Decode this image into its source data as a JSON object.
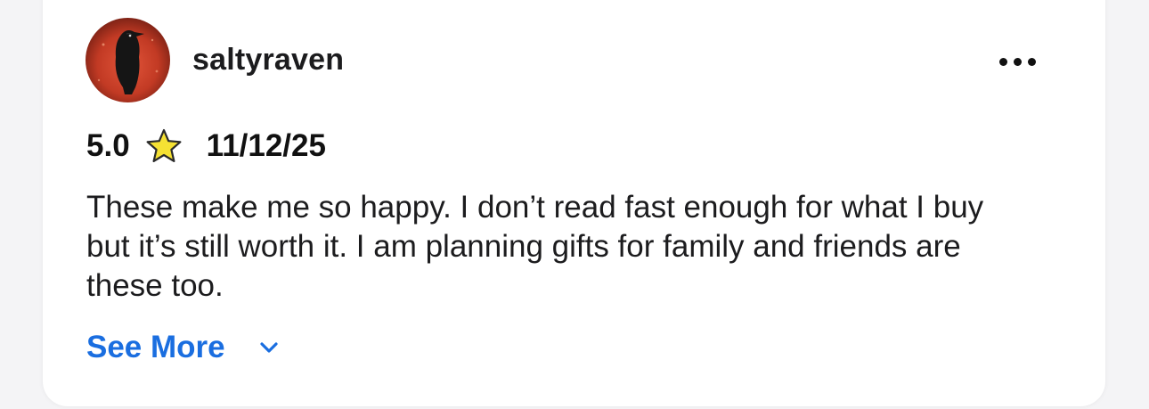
{
  "review": {
    "username": "saltyraven",
    "rating": "5.0",
    "date": "11/12/25",
    "text": "These make me so happy. I don’t read fast enough for what I buy but it’s still worth it. I am planning gifts for family and friends are these too.",
    "see_more_label": "See More",
    "star_color": "#f5e133",
    "link_color": "#1a6ee0"
  },
  "icons": {
    "menu": "more-horizontal-icon",
    "rating_star": "star-icon",
    "expand": "chevron-down-icon",
    "avatar": "raven-avatar"
  }
}
